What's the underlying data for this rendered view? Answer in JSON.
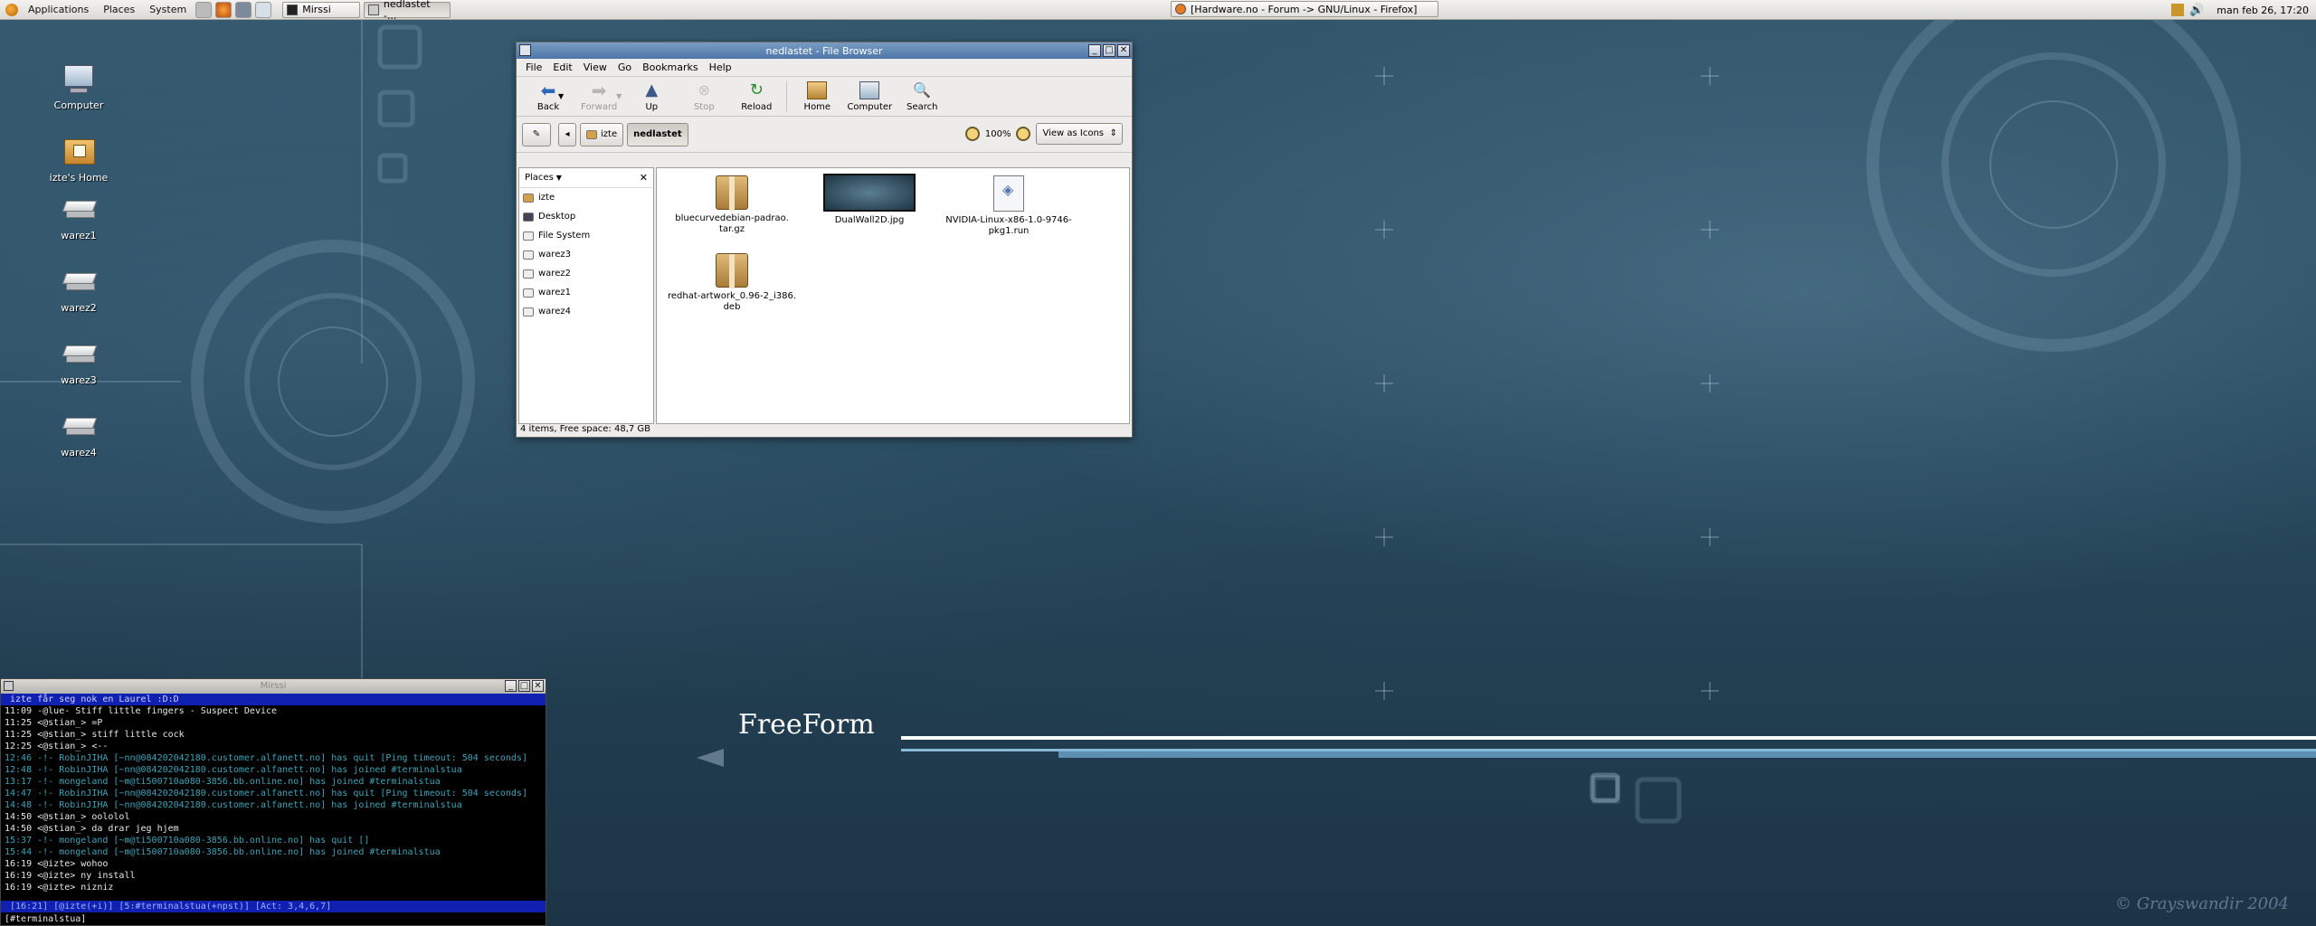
{
  "panel": {
    "menus": [
      "Applications",
      "Places",
      "System"
    ],
    "tasks": [
      {
        "label": "Mirssi",
        "active": false
      },
      {
        "label": "nedlastet -...",
        "active": true
      }
    ],
    "firefox_task": "[Hardware.no - Forum -> GNU/Linux - Firefox]",
    "clock": "man feb 26, 17:20"
  },
  "desktop": {
    "icons": [
      "Computer",
      "izte's Home",
      "warez1",
      "warez2",
      "warez3",
      "warez4"
    ],
    "freeform_text": "FreeForm",
    "signature": "© Grayswandir 2004"
  },
  "file_browser": {
    "title": "nedlastet - File Browser",
    "menus": [
      "File",
      "Edit",
      "View",
      "Go",
      "Bookmarks",
      "Help"
    ],
    "toolbar": {
      "back": "Back",
      "forward": "Forward",
      "up": "Up",
      "stop": "Stop",
      "reload": "Reload",
      "home": "Home",
      "computer": "Computer",
      "search": "Search"
    },
    "path": [
      "izte",
      "nedlastet"
    ],
    "zoom": "100%",
    "view_mode": "View as Icons",
    "sidebar_title": "Places",
    "places": [
      "izte",
      "Desktop",
      "File System",
      "warez3",
      "warez2",
      "warez1",
      "warez4"
    ],
    "files": [
      "bluecurvedebian-padrao.\ntar.gz",
      "DualWall2D.jpg",
      "NVIDIA-Linux-x86-1.0-9746-\npkg1.run",
      "redhat-artwork_0.96-2_i386.\ndeb"
    ],
    "status": "4 items, Free space: 48,7 GB"
  },
  "terminal": {
    "title": "Mirssi",
    "topic": "izte får seg nok en Laurel :D:D",
    "lines": [
      "11:09 -@lue- Stiff little fingers - Suspect Device",
      "11:25 <@stian_> =P",
      "11:25 <@stian_> stiff little cock",
      "12:25 <@stian_> <--",
      "12:46 -!- RobinJIHA [~nn@084202042180.customer.alfanett.no] has quit [Ping timeout: 504 seconds]",
      "12:48 -!- RobinJIHA [~nn@084202042180.customer.alfanett.no] has joined #terminalstua",
      "13:17 -!- mongeland [~m@ti500710a080-3856.bb.online.no] has joined #terminalstua",
      "14:47 -!- RobinJIHA [~nn@084202042180.customer.alfanett.no] has quit [Ping timeout: 504 seconds]",
      "14:48 -!- RobinJIHA [~nn@084202042180.customer.alfanett.no] has joined #terminalstua",
      "14:50 <@stian_> oololol",
      "14:50 <@stian_> da drar jeg hjem",
      "15:37 -!- mongeland [~m@ti500710a080-3856.bb.online.no] has quit []",
      "15:44 -!- mongeland [~m@ti500710a080-3856.bb.online.no] has joined #terminalstua",
      "16:19 <@izte> wohoo",
      "16:19 <@izte> ny install",
      "16:19 <@izte> nizniz"
    ],
    "status": " [16:21] [@izte(+i)] [5:#terminalstua(+npst)] [Act: 3,4,6,7]",
    "input": "[#terminalstua] "
  },
  "colors": {
    "desktop_bg": "#26465a",
    "titlebar": "#4d76a8",
    "irc_status": "#1020b0"
  }
}
